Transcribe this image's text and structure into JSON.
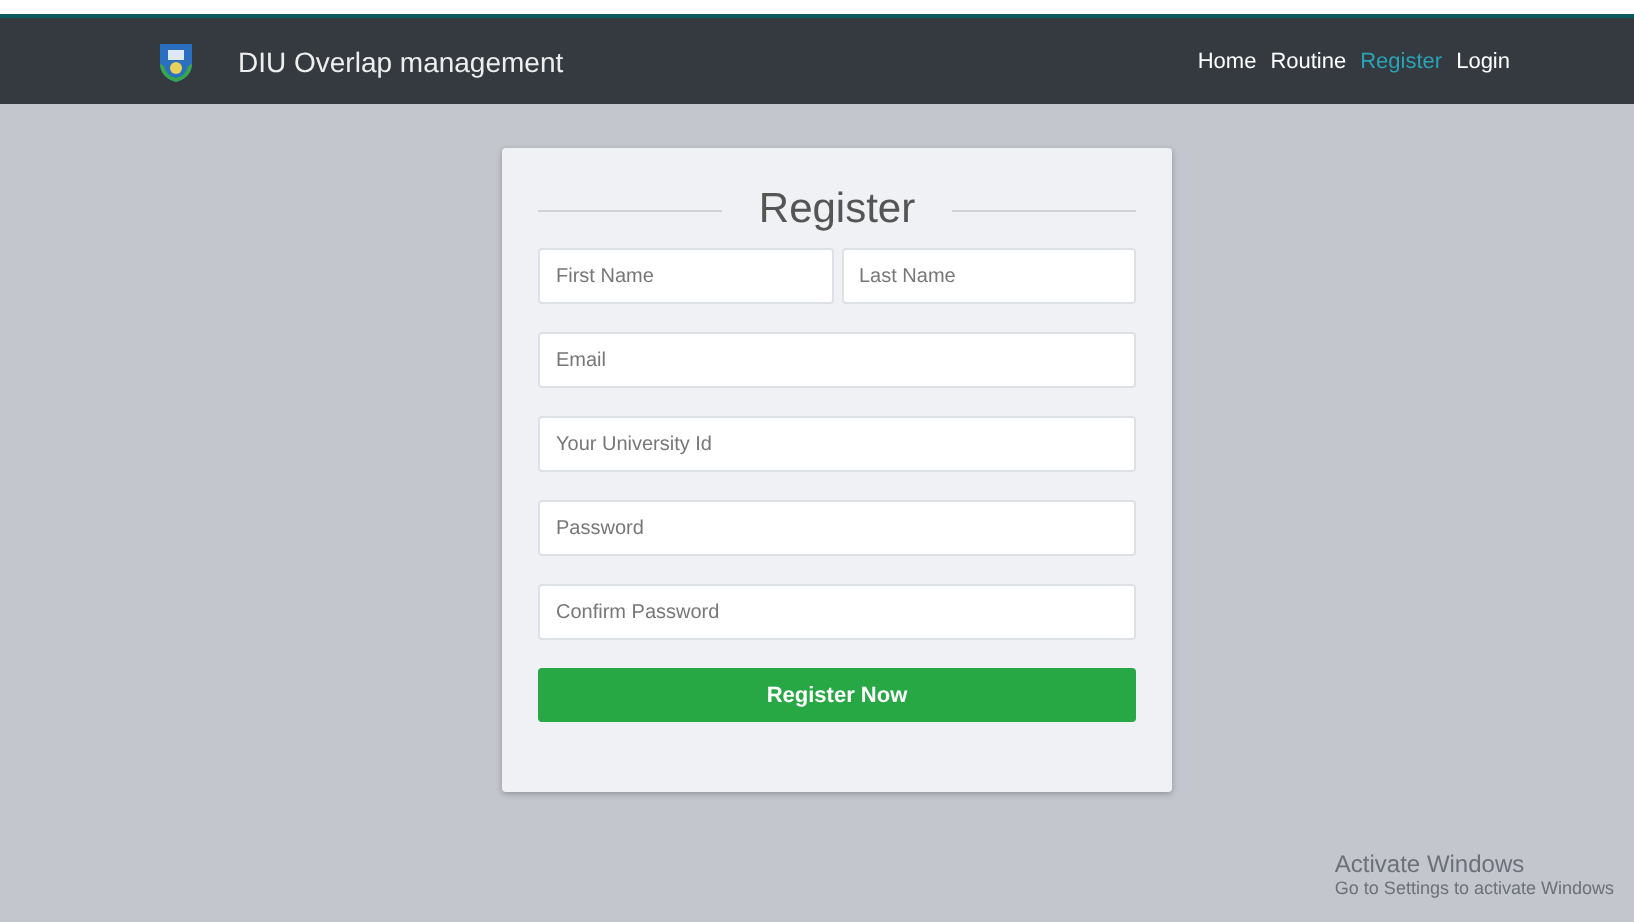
{
  "navbar": {
    "brand": "DIU Overlap management",
    "links": [
      {
        "label": "Home",
        "selected": false
      },
      {
        "label": "Routine",
        "selected": false
      },
      {
        "label": "Register",
        "selected": true
      },
      {
        "label": "Login",
        "selected": false
      }
    ]
  },
  "form": {
    "title": "Register",
    "fields": [
      {
        "placeholder": "First Name",
        "half": true
      },
      {
        "placeholder": "Last Name",
        "half": true
      },
      {
        "placeholder": "Email",
        "half": false
      },
      {
        "placeholder": "Your University Id",
        "half": false
      },
      {
        "placeholder": "Password",
        "half": false
      },
      {
        "placeholder": "Confirm Password",
        "half": false
      }
    ],
    "submit": "Register Now"
  },
  "os_notice": {
    "title": "Activate Windows",
    "subtitle": "Go to Settings to activate Windows"
  }
}
